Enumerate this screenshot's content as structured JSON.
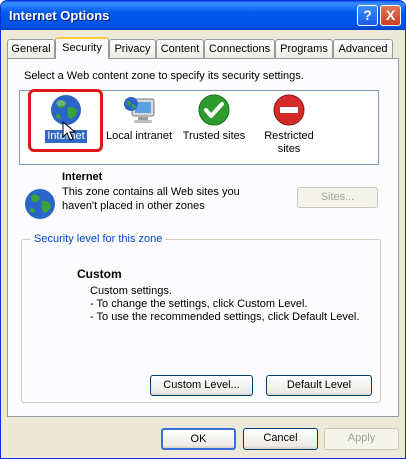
{
  "window": {
    "title": "Internet Options"
  },
  "titlebar_buttons": {
    "help": "?",
    "close": "X"
  },
  "tabs": [
    "General",
    "Security",
    "Privacy",
    "Content",
    "Connections",
    "Programs",
    "Advanced"
  ],
  "active_tab": "Security",
  "zones_prompt": "Select a Web content zone to specify its security settings.",
  "zones": [
    {
      "label": "Internet",
      "icon": "globe-icon"
    },
    {
      "label": "Local intranet",
      "icon": "computer-globe-icon"
    },
    {
      "label": "Trusted sites",
      "icon": "check-icon"
    },
    {
      "label": "Restricted sites",
      "label_line1": "Restricted",
      "label_line2": "sites",
      "icon": "no-entry-icon"
    }
  ],
  "selected_zone": {
    "name": "Internet",
    "description_line1": "This zone contains all Web sites you",
    "description_line2": "haven't placed in other zones",
    "sites_button": "Sites..."
  },
  "security_level": {
    "group_title": "Security level for this zone",
    "level_name": "Custom",
    "line1": "Custom settings.",
    "line2": "- To change the settings, click Custom Level.",
    "line3": "- To use the recommended settings, click Default Level.",
    "custom_level_button": "Custom Level...",
    "default_level_button": "Default Level"
  },
  "dialog_buttons": {
    "ok": "OK",
    "cancel": "Cancel",
    "apply": "Apply"
  },
  "colors": {
    "titlebar": "#0054e3",
    "selection_highlight": "#e01818",
    "group_title": "#0046d5"
  }
}
